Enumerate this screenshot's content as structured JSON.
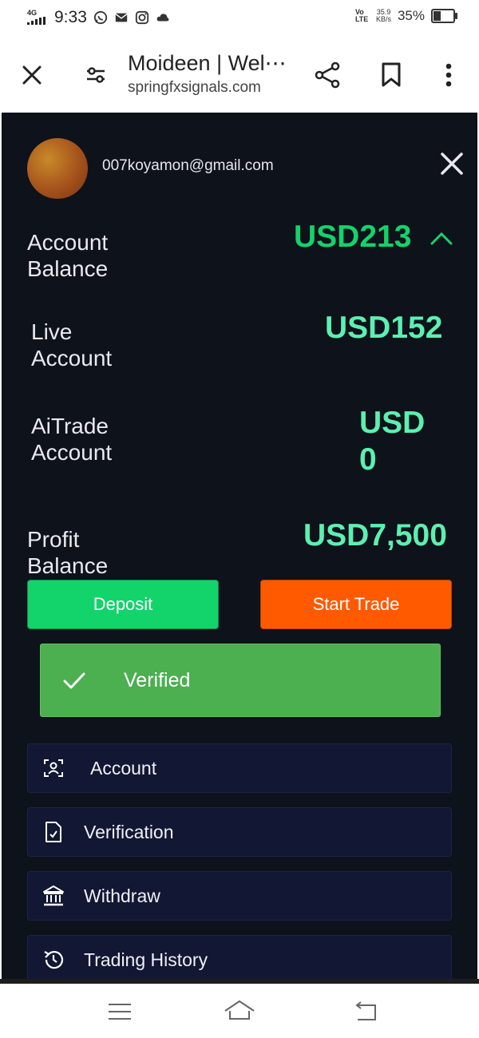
{
  "status_bar": {
    "network": "4G",
    "time": "9:33",
    "volte": "Vo LTE",
    "speed_value": "35.9",
    "speed_unit": "KB/s",
    "battery": "35%",
    "battery_level": 0.35
  },
  "browser": {
    "page_title": "Moideen | Wel⋯",
    "domain": "springfxsignals.com"
  },
  "panel": {
    "email": "007koyamon@gmail.com",
    "account_balance_label": "Account Balance",
    "account_balance_value": "USD213",
    "live_account_label": "Live Account",
    "live_account_value": "USD152",
    "aitrade_label": "AiTrade Account",
    "aitrade_value_line1": "USD",
    "aitrade_value_line2": "0",
    "profit_label": "Profit Balance",
    "profit_value": "USD7,500",
    "deposit_label": "Deposit",
    "start_trade_label": "Start Trade",
    "verified_label": "Verified",
    "menu": [
      {
        "label": "Account",
        "icon": "account-scan-icon"
      },
      {
        "label": "Verification",
        "icon": "verification-doc-icon"
      },
      {
        "label": "Withdraw",
        "icon": "bank-icon"
      },
      {
        "label": "Trading History",
        "icon": "history-icon"
      }
    ]
  },
  "colors": {
    "panel_bg": "#0e121b",
    "balance_green": "#13d36b",
    "value_mint": "#5cf0b0",
    "deposit_green": "#13d36b",
    "trade_orange": "#ff5a00",
    "verified_green": "#4caf50",
    "menu_bg": "#121733"
  }
}
